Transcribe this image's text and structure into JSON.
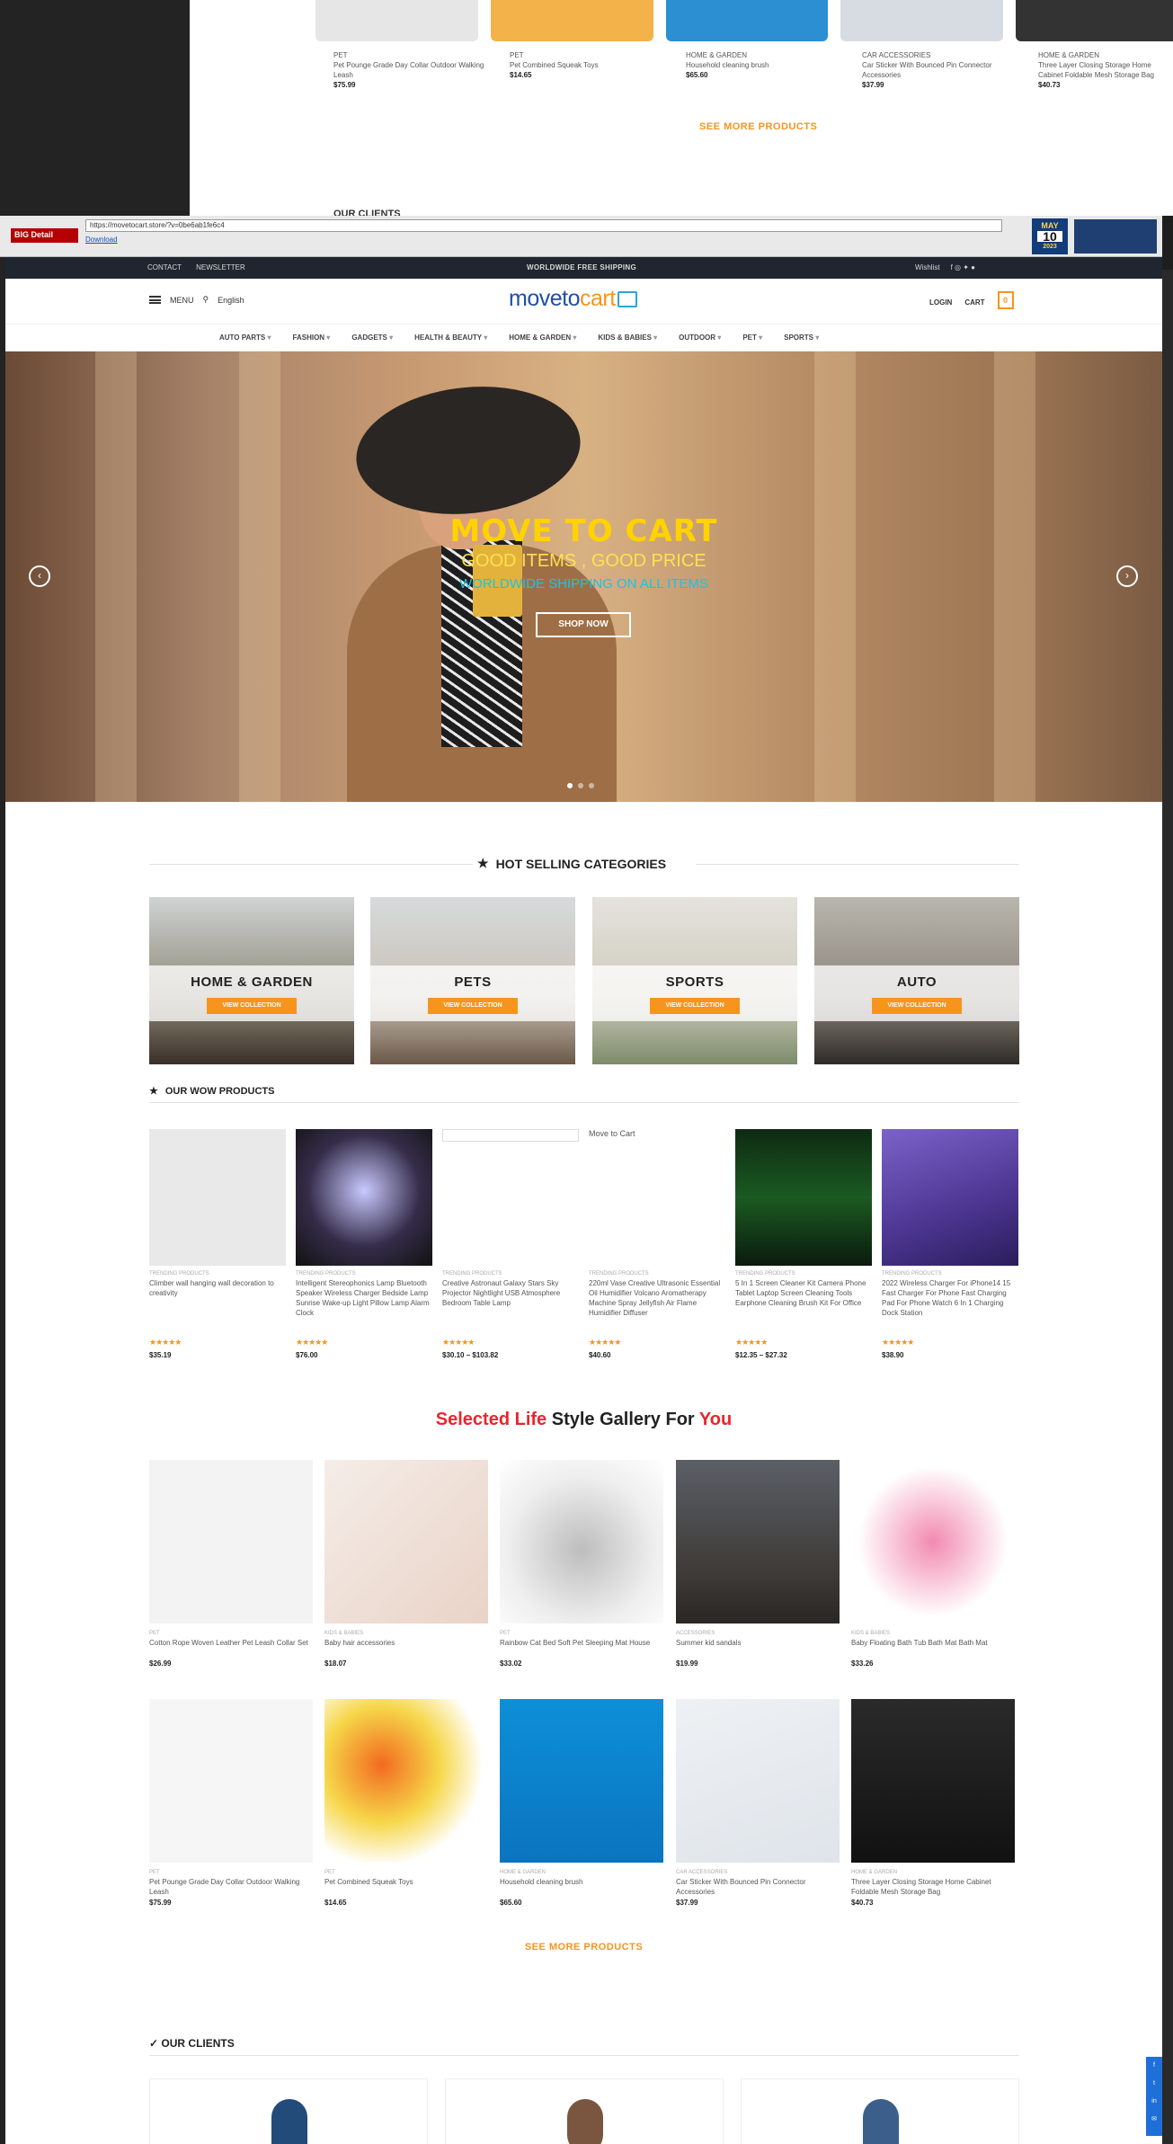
{
  "top_shot": {
    "products": [
      {
        "cat": "PET",
        "name": "Pet Pounge Grade Day Collar Outdoor Walking Leash",
        "price": "$75.99"
      },
      {
        "cat": "PET",
        "name": "Pet Combined Squeak Toys",
        "price": "$14.65"
      },
      {
        "cat": "HOME & GARDEN",
        "name": "Household cleaning brush",
        "price": "$65.60"
      },
      {
        "cat": "CAR ACCESSORIES",
        "name": "Car Sticker With Bounced Pin Connector Accessories",
        "price": "$37.99"
      },
      {
        "cat": "HOME & GARDEN",
        "name": "Three Layer Closing Storage Home Cabinet Foldable Mesh Storage Bag",
        "price": "$40.73"
      }
    ],
    "see_more": "SEE MORE PRODUCTS",
    "clients": "OUR CLIENTS"
  },
  "browser": {
    "logo": "BIG Detail",
    "url": "https://movetocart.store/?v=0be6ab1fe6c4",
    "link": "Download",
    "date_month": "MAY",
    "date_day": "10",
    "date_year": "2023"
  },
  "topbar": {
    "contact": "CONTACT",
    "newsletter": "NEWSLETTER",
    "center": "WORLDWIDE FREE SHIPPING",
    "wishlist": "Wishlist"
  },
  "header": {
    "menu": "MENU",
    "language": "English",
    "logo_a": "moveto",
    "logo_b": "cart",
    "login": "LOGIN",
    "cart": "CART",
    "cart_count": "0"
  },
  "nav": [
    "AUTO PARTS",
    "FASHION",
    "GADGETS",
    "HEALTH & BEAUTY",
    "HOME & GARDEN",
    "KIDS & BABIES",
    "OUTDOOR",
    "PET",
    "SPORTS"
  ],
  "hero": {
    "title": "MOVE TO CART",
    "sub1": "GOOD ITEMS , GOOD PRICE",
    "sub2": "WORLDWIDE SHIPPING ON ALL ITEMS",
    "button": "SHOP NOW"
  },
  "hot": {
    "title": "HOT SELLING CATEGORIES",
    "button": "VIEW COLLECTION",
    "items": [
      "HOME & GARDEN",
      "PETS",
      "SPORTS",
      "AUTO"
    ]
  },
  "wow": {
    "title": "OUR WOW PRODUCTS",
    "broken_alt": "Move to Cart",
    "items": [
      {
        "cat": "TRENDING PRODUCTS",
        "name": "Climber wall hanging wall decoration to creativity",
        "price": "$35.19"
      },
      {
        "cat": "TRENDING PRODUCTS",
        "name": "Intelligent Stereophonics Lamp Bluetooth Speaker Wireless Charger Bedside Lamp Sunrise Wake-up Light Pillow Lamp Alarm Clock",
        "price": "$76.00"
      },
      {
        "cat": "TRENDING PRODUCTS",
        "name": "Creative Astronaut Galaxy Stars Sky Projector Nightlight USB Atmosphere Bedroom Table Lamp",
        "price": "$30.10 – $103.82"
      },
      {
        "cat": "TRENDING PRODUCTS",
        "name": "220ml Vase Creative Ultrasonic Essential Oil Humidifier Volcano Aromatherapy Machine Spray Jellyfish Air Flame Humidifier Diffuser",
        "price": "$40.60"
      },
      {
        "cat": "TRENDING PRODUCTS",
        "name": "5 In 1 Screen Cleaner Kit Camera Phone Tablet Laptop Screen Cleaning Tools Earphone Cleaning Brush Kit For Office",
        "price": "$12.35 – $27.32"
      },
      {
        "cat": "TRENDING PRODUCTS",
        "name": "2022 Wireless Charger For iPhone14 15 Fast Charger For Phone Fast Charging Pad For Phone Watch 6 In 1 Charging Dock Station",
        "price": "$38.90"
      }
    ]
  },
  "gallery": {
    "title_a": "Selected",
    "title_b": "Life",
    "title_c": "Style Gallery For",
    "title_d": "You",
    "items": [
      {
        "cat": "PET",
        "name": "Cotton Rope Woven Leather Pet Leash Collar Set",
        "price": "$26.99"
      },
      {
        "cat": "KIDS & BABIES",
        "name": "Baby hair accessories",
        "price": "$18.07"
      },
      {
        "cat": "PET",
        "name": "Rainbow Cat Bed Soft Pet Sleeping Mat House",
        "price": "$33.02"
      },
      {
        "cat": "ACCESSORIES",
        "name": "Summer kid sandals",
        "price": "$19.99"
      },
      {
        "cat": "KIDS & BABIES",
        "name": "Baby Floating Bath Tub Bath Mat Bath Mat",
        "price": "$33.26"
      },
      {
        "cat": "PET",
        "name": "Pet Pounge Grade Day Collar Outdoor Walking Leash",
        "price": "$75.99"
      },
      {
        "cat": "PET",
        "name": "Pet Combined Squeak Toys",
        "price": "$14.65"
      },
      {
        "cat": "HOME & GARDEN",
        "name": "Household cleaning brush",
        "price": "$65.60"
      },
      {
        "cat": "CAR ACCESSORIES",
        "name": "Car Sticker With Bounced Pin Connector Accessories",
        "price": "$37.99"
      },
      {
        "cat": "HOME & GARDEN",
        "name": "Three Layer Closing Storage Home Cabinet Foldable Mesh Storage Bag",
        "price": "$40.73"
      }
    ],
    "see_more": "SEE MORE PRODUCTS"
  },
  "clients": {
    "title": "OUR CLIENTS"
  },
  "colors": {
    "accent": "#f7941d",
    "brand": "#1f4fa8",
    "red": "#e8262e",
    "topbar": "#1f2630"
  }
}
